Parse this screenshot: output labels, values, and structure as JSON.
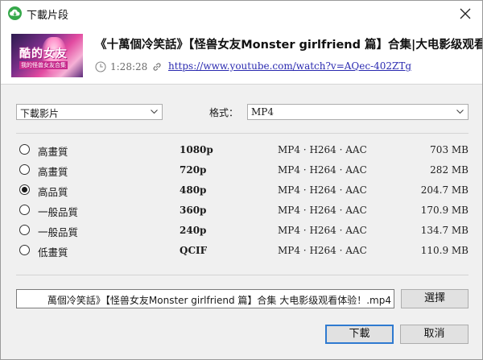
{
  "window": {
    "title": "下載片段",
    "app_icon": "download-cloud-icon",
    "close_icon": "close-icon"
  },
  "video": {
    "title": "《十萬個冷笑話》【怪兽女友Monster girlfriend 篇】合集|大电影级观看",
    "thumbnail_text": "酷的女友",
    "thumbnail_subtext": "我的怪兽女友合集",
    "duration": "1:28:28",
    "url": "https://www.youtube.com/watch?v=AQec-402ZTg"
  },
  "options": {
    "type_select": "下載影片",
    "format_label": "格式：",
    "format_select": "MP4"
  },
  "qualities": [
    {
      "label": "高畫質",
      "resolution": "1080p",
      "codec": "MP4 · H264 · AAC",
      "size": "703 MB",
      "selected": false
    },
    {
      "label": "高畫質",
      "resolution": "720p",
      "codec": "MP4 · H264 · AAC",
      "size": "282 MB",
      "selected": false
    },
    {
      "label": "高品質",
      "resolution": "480p",
      "codec": "MP4 · H264 · AAC",
      "size": "204.7 MB",
      "selected": true
    },
    {
      "label": "一般品質",
      "resolution": "360p",
      "codec": "MP4 · H264 · AAC",
      "size": "170.9 MB",
      "selected": false
    },
    {
      "label": "一般品質",
      "resolution": "240p",
      "codec": "MP4 · H264 · AAC",
      "size": "134.7 MB",
      "selected": false
    },
    {
      "label": "低畫質",
      "resolution": "QCIF",
      "codec": "MP4 · H264 · AAC",
      "size": "110.9 MB",
      "selected": false
    }
  ],
  "output": {
    "filename": "萬個冷笑話》【怪兽女友Monster girlfriend 篇】合集 大电影级观看体验！.mp4",
    "choose_label": "選擇"
  },
  "buttons": {
    "download": "下載",
    "cancel": "取消"
  },
  "colors": {
    "accent": "#2f7ad0",
    "app_icon": "#35a84a",
    "link": "#2a2ab0"
  }
}
